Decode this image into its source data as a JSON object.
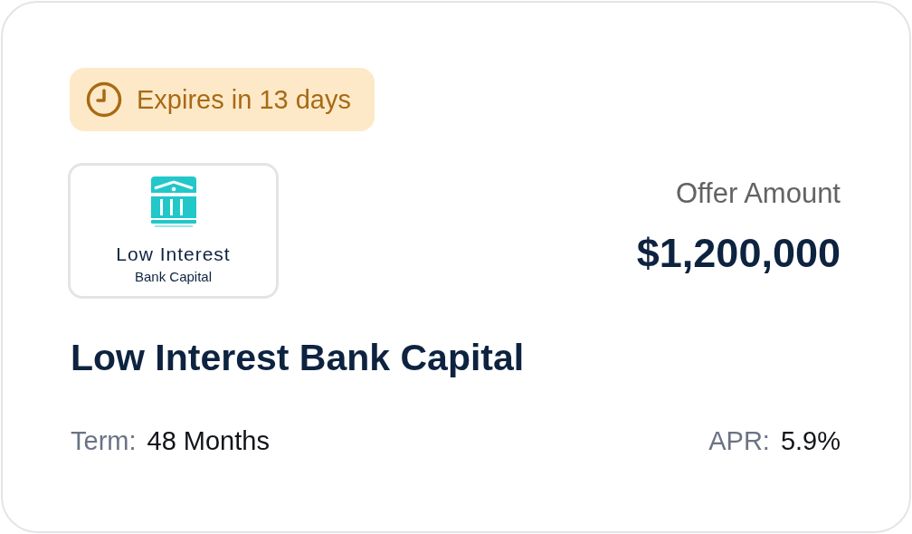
{
  "expiry_badge": {
    "text": "Expires in 13 days"
  },
  "lender_logo": {
    "line_1": "Low Interest",
    "line_2": "Bank Capital"
  },
  "offer": {
    "label": "Offer Amount",
    "amount": "$1,200,000"
  },
  "lender_name": "Low Interest Bank Capital",
  "term": {
    "label": "Term:",
    "value": "48 Months"
  },
  "apr": {
    "label": "APR:",
    "value": "5.9%"
  }
}
